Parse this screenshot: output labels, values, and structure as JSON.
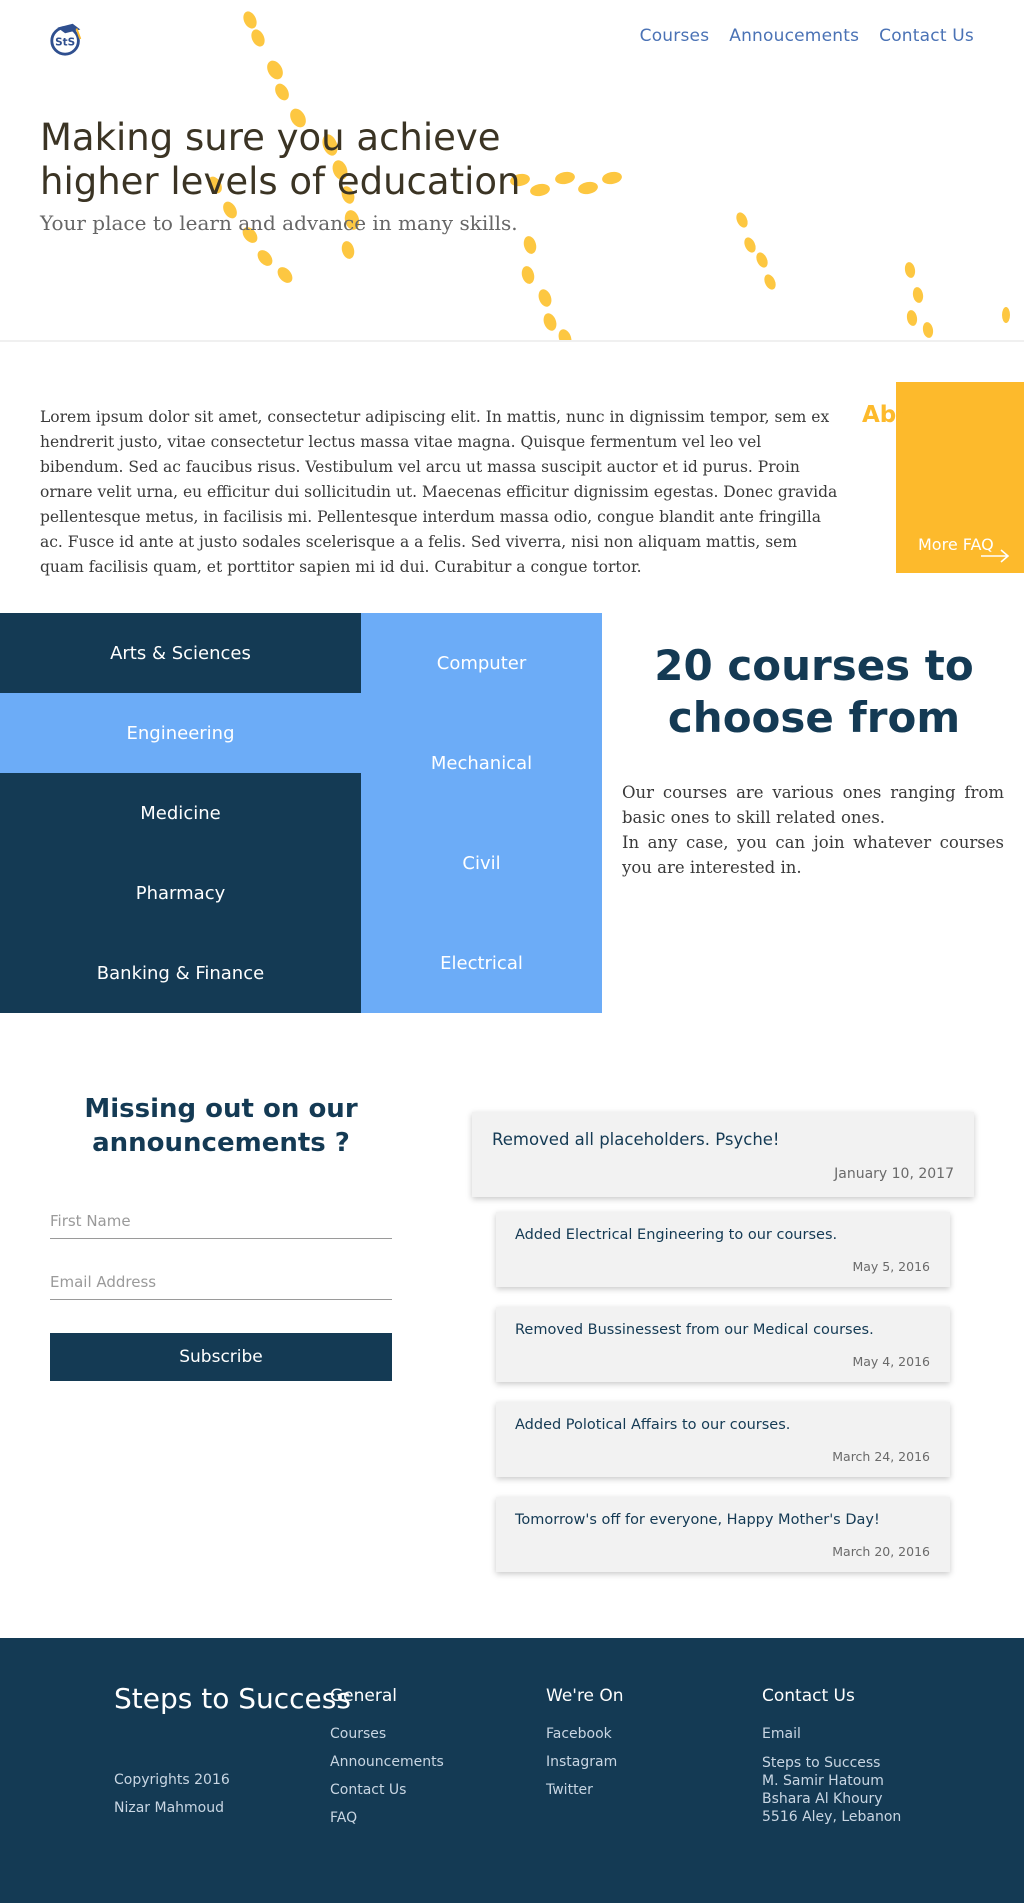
{
  "brand": {
    "logo_text": "StS"
  },
  "nav": {
    "items": [
      "Courses",
      "Annoucements",
      "Contact Us"
    ],
    "color": "#4a72b5"
  },
  "hero": {
    "title": "Making sure you achieve higher levels of education",
    "subtitle": "Your place to learn and advance in many skills.",
    "accent": "#fdba2c"
  },
  "about": {
    "title": "About",
    "text": "Lorem ipsum dolor sit amet, consectetur adipiscing elit. In mattis, nunc in dignissim tempor, sem ex hendrerit justo, vitae consectetur lectus massa vitae magna. Quisque fermentum vel leo vel bibendum. Sed ac faucibus risus. Vestibulum vel arcu ut massa suscipit auctor et id purus. Proin ornare velit urna, eu efficitur dui sollicitudin ut. Maecenas efficitur dignissim egestas. Donec gravida pellentesque metus, in facilisis mi. Pellentesque interdum massa odio, congue blandit ante fringilla ac. Fusce id ante at justo sodales scelerisque a a felis. Sed viverra, nisi non aliquam mattis, sem quam facilisis quam, et porttitor sapien mi id dui. Curabitur a congue tortor.",
    "faq_link": "More FAQ"
  },
  "courses": {
    "categories": [
      "Arts & Sciences",
      "Engineering",
      "Medicine",
      "Pharmacy",
      "Banking & Finance"
    ],
    "active_category": "Engineering",
    "subcategories": [
      "Computer",
      "Mechanical",
      "Civil",
      "Electrical"
    ],
    "count": "20",
    "heading_rest": "courses to choose from",
    "desc_1": "Our courses are various ones ranging from basic ones to skill related ones.",
    "desc_2": "In any case, you can join whatever courses you are interested in.",
    "dark": "#143a54",
    "light": "#6cacf7"
  },
  "announcements": {
    "heading": "Missing out on our announcements ?",
    "first_name_placeholder": "First Name",
    "email_placeholder": "Email Address",
    "subscribe_label": "Subscribe",
    "items": [
      {
        "title": "Removed all placeholders. Psyche!",
        "date": "January 10, 2017"
      },
      {
        "title": "Added Electrical Engineering to our courses.",
        "date": "May 5, 2016"
      },
      {
        "title": "Removed Bussinessest from our Medical courses.",
        "date": "May 4, 2016"
      },
      {
        "title": "Added Polotical Affairs to our courses.",
        "date": "March 24, 2016"
      },
      {
        "title": "Tomorrow's off for everyone, Happy Mother's Day!",
        "date": "March 20, 2016"
      }
    ]
  },
  "footer": {
    "brand": "Steps to Success",
    "copyright": "Copyrights 2016",
    "author": "Nizar Mahmoud",
    "general": {
      "title": "General",
      "links": [
        "Courses",
        "Announcements",
        "Contact Us",
        "FAQ"
      ]
    },
    "social": {
      "title": "We're On",
      "links": [
        "Facebook",
        "Instagram",
        "Twitter"
      ]
    },
    "contact": {
      "title": "Contact Us",
      "email": "Email",
      "address": [
        "Steps to Success",
        "M. Samir Hatoum",
        "Bshara Al Khoury",
        "5516 Aley, Lebanon"
      ]
    }
  }
}
